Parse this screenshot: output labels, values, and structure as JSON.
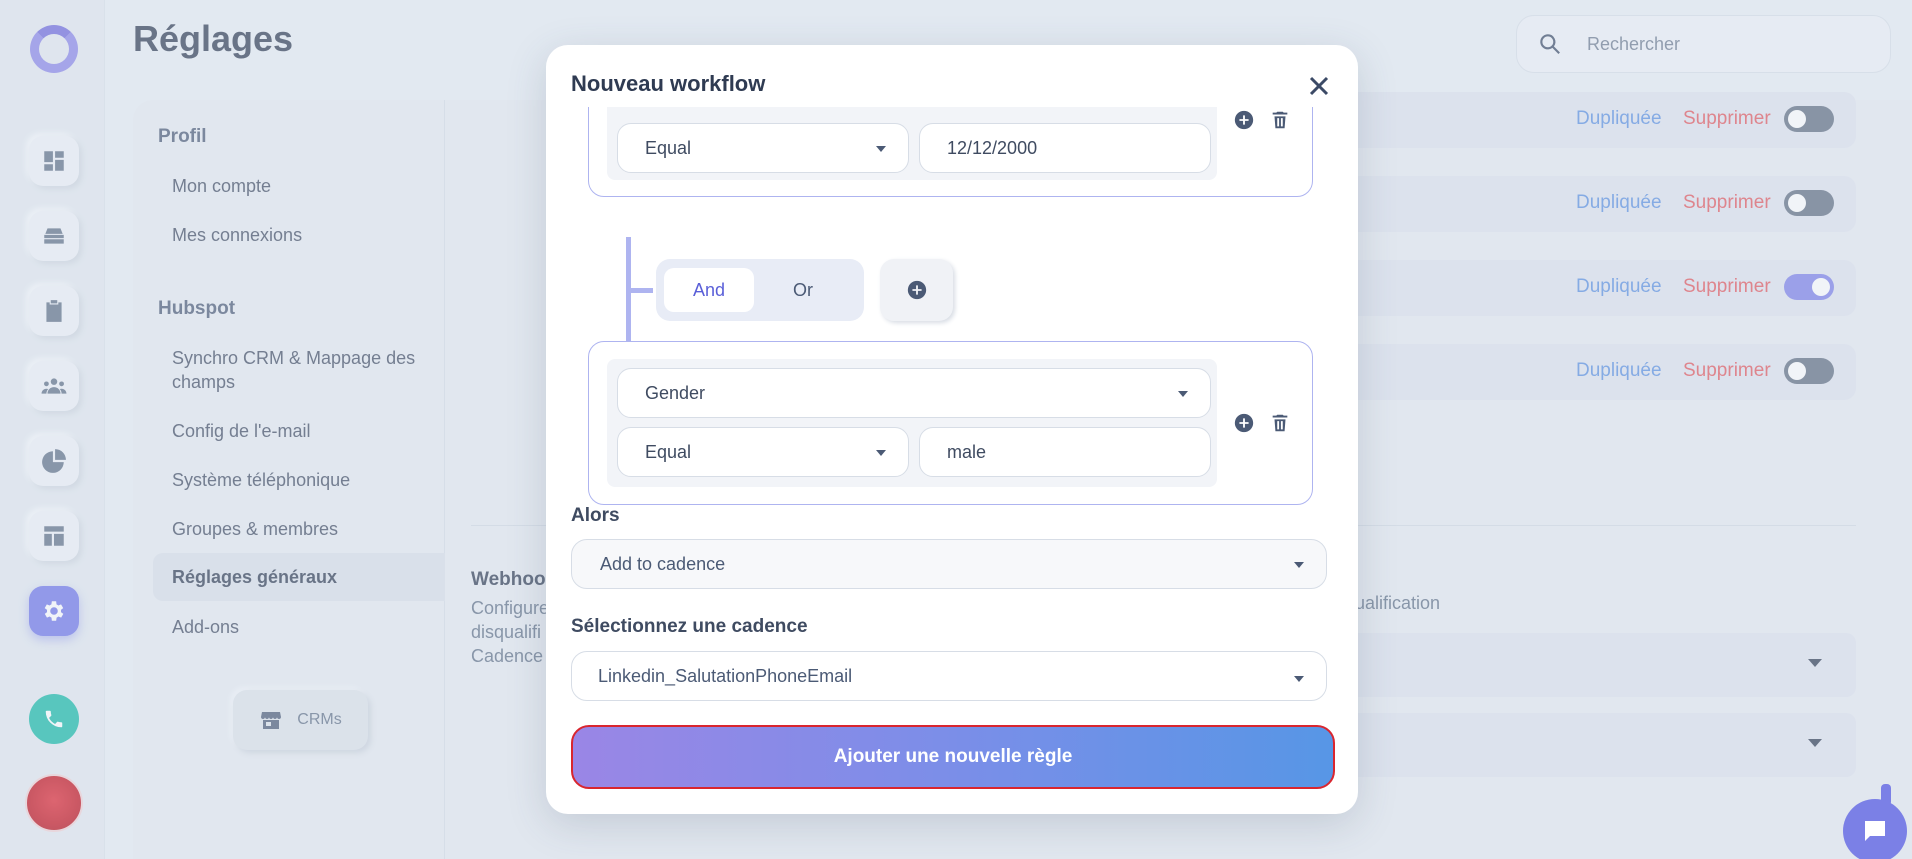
{
  "page": {
    "title": "Réglages"
  },
  "search": {
    "placeholder": "Rechercher"
  },
  "settings_nav": {
    "sections": [
      {
        "title": "Profil",
        "items": [
          "Mon compte",
          "Mes connexions"
        ]
      },
      {
        "title": "Hubspot",
        "items": [
          "Synchro CRM & Mappage des champs",
          "Config de l'e-mail",
          "Système téléphonique",
          "Groupes & membres",
          "Réglages généraux",
          "Add-ons"
        ]
      }
    ],
    "active_item": "Réglages généraux",
    "crms_button": "CRMs"
  },
  "workflow_rows": [
    {
      "duplicate": "Dupliquée",
      "delete": "Supprimer",
      "enabled": false
    },
    {
      "duplicate": "Dupliquée",
      "delete": "Supprimer",
      "enabled": false
    },
    {
      "duplicate": "Dupliquée",
      "delete": "Supprimer",
      "enabled": true
    },
    {
      "duplicate": "Dupliquée",
      "delete": "Supprimer",
      "enabled": false
    }
  ],
  "webhook": {
    "title": "Webhook",
    "desc_line1": "Configure",
    "desc_line2": "disqualifi",
    "desc_line3": "Cadence",
    "tail": "ualification"
  },
  "modal": {
    "title": "Nouveau workflow",
    "conditions": [
      {
        "operator": "Equal",
        "value": "12/12/2000"
      },
      {
        "field": "Gender",
        "operator": "Equal",
        "value": "male"
      }
    ],
    "logic": {
      "and_label": "And",
      "or_label": "Or",
      "selected": "And"
    },
    "then_label": "Alors",
    "then_action": "Add to cadence",
    "cadence_label": "Sélectionnez une cadence",
    "cadence_value": "Linkedin_SalutationPhoneEmail",
    "submit_label": "Ajouter une nouvelle règle"
  },
  "colors": {
    "accent": "#6d73e8",
    "duplicate": "#5a8fe0",
    "delete": "#e2555b",
    "button_gradient_start": "#9a86e6",
    "button_gradient_end": "#5796e6"
  }
}
